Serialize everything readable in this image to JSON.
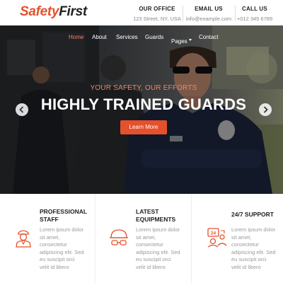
{
  "brand": {
    "part1": "Safety",
    "part2": "First"
  },
  "contact": [
    {
      "title": "OUR OFFICE",
      "value": "123 Street, NY, USA"
    },
    {
      "title": "EMAIL US",
      "value": "info@example.com"
    },
    {
      "title": "CALL US",
      "value": "+012 345 6789"
    }
  ],
  "nav": {
    "items": [
      {
        "label": "Home",
        "active": true
      },
      {
        "label": "About"
      },
      {
        "label": "Services"
      },
      {
        "label": "Guards"
      },
      {
        "label": "Pages"
      },
      {
        "label": "Contact"
      }
    ]
  },
  "hero": {
    "subtitle": "YOUR SAFETY, OUR EFFORTS",
    "title": "HIGHLY TRAINED GUARDS",
    "button": "Learn More",
    "prev_icon": "chevron-left-icon",
    "next_icon": "chevron-right-icon"
  },
  "features": [
    {
      "icon": "security-officer-icon",
      "title_line1": "PROFESSIONAL",
      "title_line2": "STAFF",
      "text": [
        "Lorem ipsum dolor",
        "sit amet,",
        "consectetur",
        "adipiscing elit. Sed",
        "eu suscipit orci",
        "velit id libero"
      ]
    },
    {
      "icon": "helmet-goggles-icon",
      "title_line1": "LATEST",
      "title_line2": "EQUIPMENTS",
      "text": [
        "Lorem ipsum dolor",
        "sit amet,",
        "consectetur",
        "adipiscing elit. Sed",
        "eu suscipit orci",
        "velit id libero"
      ]
    },
    {
      "icon": "support-24-7-icon",
      "title_line1": "24/7 SUPPORT",
      "title_line2": "",
      "text": [
        "Lorem ipsum dolor",
        "sit amet,",
        "consectetur",
        "adipiscing elit. Sed",
        "eu suscipit orci",
        "velit id libero"
      ]
    }
  ],
  "colors": {
    "accent": "#e4512c",
    "accent_light": "#f0846a",
    "dark": "#222222",
    "muted": "#999999"
  }
}
